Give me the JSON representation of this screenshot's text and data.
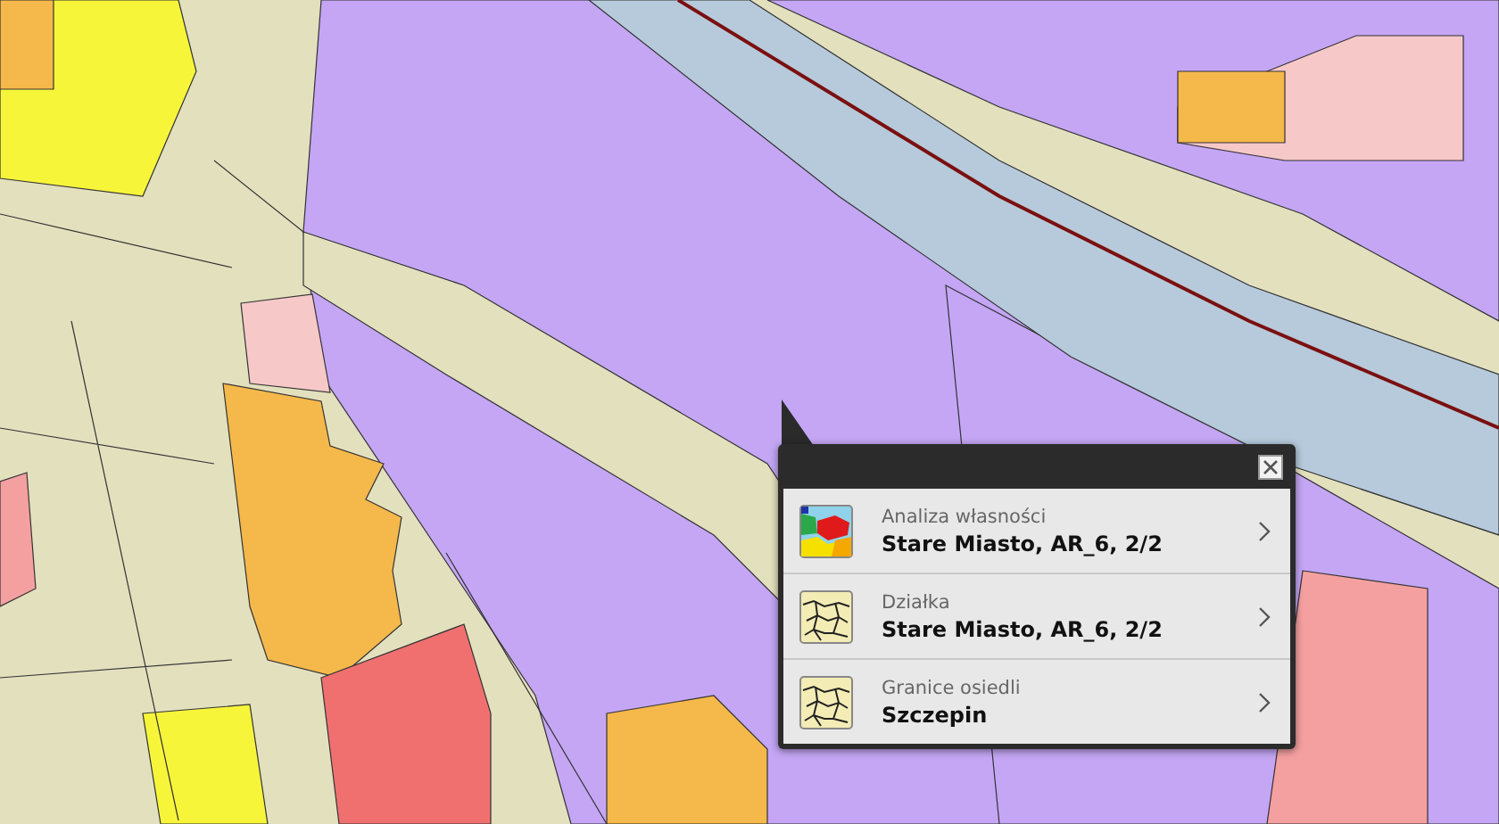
{
  "popup": {
    "items": [
      {
        "kind": "ownership",
        "layer": "Analiza własności",
        "value": "Stare Miasto, AR_6, 2/2"
      },
      {
        "kind": "parcel",
        "layer": "Działka",
        "value": "Stare Miasto, AR_6, 2/2"
      },
      {
        "kind": "parcel",
        "layer": "Granice osiedli",
        "value": "Szczepin"
      }
    ]
  }
}
